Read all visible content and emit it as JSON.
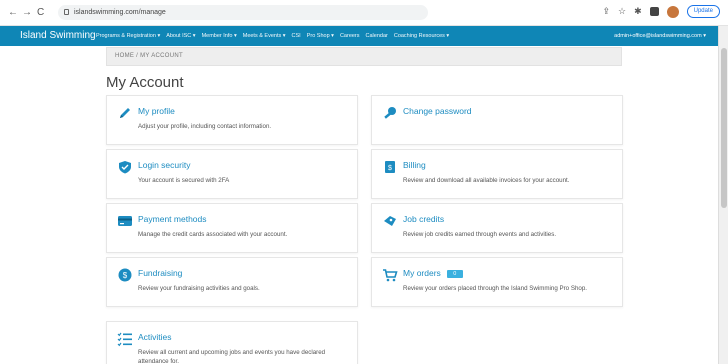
{
  "browser": {
    "url": "islandswimming.com/manage",
    "update_label": "Update"
  },
  "site": {
    "brand": "Island Swimming",
    "menu": [
      "Programs & Registration ▾",
      "About ISC ▾",
      "Member Info ▾",
      "Meets & Events ▾",
      "CSI",
      "Pro Shop ▾",
      "Careers",
      "Calendar",
      "Coaching Resources ▾"
    ],
    "account_email": "admin+office@islandswimming.com ▾"
  },
  "breadcrumb": "HOME / MY ACCOUNT",
  "page_title": "My Account",
  "cards": [
    {
      "title": "My profile",
      "desc": "Adjust your profile, including contact information.",
      "icon": "pencil-icon"
    },
    {
      "title": "Change password",
      "desc": "",
      "icon": "key-icon"
    },
    {
      "title": "Login security",
      "desc": "Your account is secured with 2FA",
      "icon": "shield-icon"
    },
    {
      "title": "Billing",
      "desc": "Review and download all available invoices for your account.",
      "icon": "invoice-icon"
    },
    {
      "title": "Payment methods",
      "desc": "Manage the credit cards associated with your account.",
      "icon": "credit-card-icon"
    },
    {
      "title": "Job credits",
      "desc": "Review job credits earned through events and activities.",
      "icon": "ticket-icon"
    },
    {
      "title": "Fundraising",
      "desc": "Review your fundraising activities and goals.",
      "icon": "dollar-icon"
    },
    {
      "title": "My orders",
      "badge": "0",
      "desc": "Review your orders placed through the Island Swimming Pro Shop.",
      "icon": "cart-icon"
    },
    {
      "title": "Activities",
      "desc": "Review all current and upcoming jobs and events you have declared attendance for.",
      "icon": "checklist-icon"
    }
  ],
  "colors": {
    "nav_bg": "#0f86b6",
    "link": "#1d8cc1",
    "icon": "#1d8cc1"
  }
}
